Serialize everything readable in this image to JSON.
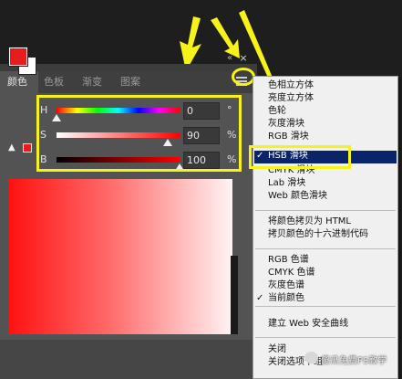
{
  "panel": {
    "collapse_glyph": "«",
    "close_glyph": "×",
    "tabs": [
      {
        "label": "颜色",
        "active": true
      },
      {
        "label": "色板",
        "active": false
      },
      {
        "label": "渐变",
        "active": false
      },
      {
        "label": "图案",
        "active": false
      }
    ],
    "foreground_color": "#e81c1c",
    "background_color": "#ffffff",
    "warning_icon": "warning-triangle-icon",
    "sliders": [
      {
        "label": "H",
        "value": "0",
        "unit": "°",
        "fraction": 0.0
      },
      {
        "label": "S",
        "value": "90",
        "unit": "%",
        "fraction": 0.9
      },
      {
        "label": "B",
        "value": "100",
        "unit": "%",
        "fraction": 1.0
      }
    ]
  },
  "menu": {
    "items": [
      {
        "label": "色相立方体",
        "checked": false
      },
      {
        "label": "亮度立方体",
        "checked": false
      },
      {
        "label": "色轮",
        "checked": false
      },
      {
        "label": "灰度滑块",
        "checked": false
      },
      {
        "label": "RGB 滑块",
        "checked": false
      },
      {
        "label": "HSB 滑块",
        "checked": true,
        "selected": true
      },
      {
        "label": "CMYK 滑块",
        "checked": false
      },
      {
        "label": "Lab 滑块",
        "checked": false
      },
      {
        "label": "Web 颜色滑块",
        "checked": false
      },
      {
        "label": "将颜色拷贝为 HTML",
        "checked": false
      },
      {
        "label": "拷贝颜色的十六进制代码",
        "checked": false
      },
      {
        "label": "RGB 色谱",
        "checked": false
      },
      {
        "label": "CMYK 色谱",
        "checked": false
      },
      {
        "label": "灰度色谱",
        "checked": false
      },
      {
        "label": "当前颜色",
        "checked": true
      },
      {
        "label": "建立 Web 安全曲线",
        "checked": false
      },
      {
        "label": "关闭",
        "checked": false
      },
      {
        "label": "关闭选项卡组",
        "checked": false
      }
    ],
    "check_glyph": "✓"
  },
  "annotations": {
    "highlight_color": "#f5f31a"
  },
  "watermark": {
    "text": "傻瓜免费PS教学"
  }
}
